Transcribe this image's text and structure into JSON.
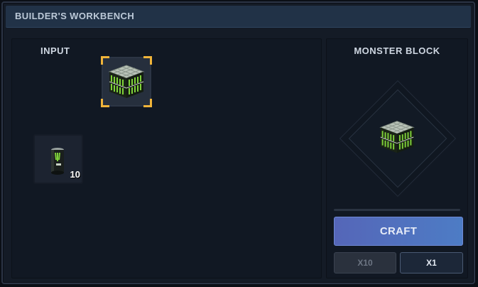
{
  "window": {
    "title": "BUILDER'S WORKBENCH"
  },
  "input": {
    "label": "INPUT",
    "slots": [
      {
        "item_icon": "monster-block-icon",
        "selected": true,
        "count": ""
      },
      {
        "item_icon": "energy-can-icon",
        "selected": false,
        "count": "10"
      }
    ]
  },
  "output": {
    "label": "MONSTER BLOCK",
    "item_icon": "monster-block-icon"
  },
  "actions": {
    "craft_label": "CRAFT",
    "x10_label": "X10",
    "x1_label": "X1",
    "x10_enabled": false,
    "x1_enabled": true
  },
  "colors": {
    "selection_corner": "#f0b43a",
    "craft_button": "#5170c0",
    "can_green": "#7fd23a",
    "titlebar": "#213247"
  }
}
